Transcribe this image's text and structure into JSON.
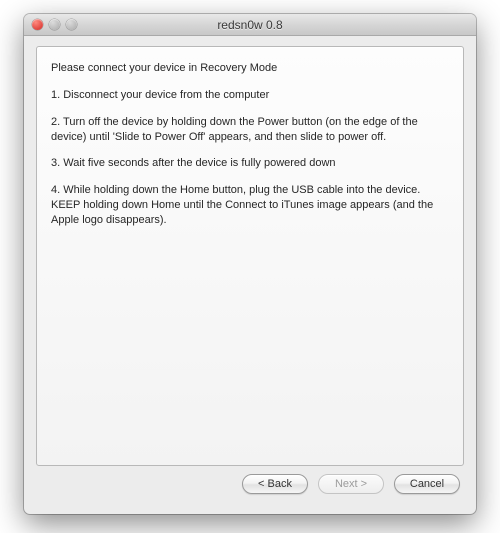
{
  "window": {
    "title": "redsn0w 0.8"
  },
  "content": {
    "heading": "Please connect your device in Recovery Mode",
    "step1": "1. Disconnect your device from the computer",
    "step2": "2. Turn off the device by holding down the Power button (on the edge of the device) until 'Slide to Power Off' appears, and then slide to power off.",
    "step3": "3. Wait five seconds after the device is fully powered down",
    "step4": "4. While holding down the Home button, plug the USB cable into the device. KEEP holding down Home until the Connect to iTunes image appears (and the Apple logo disappears)."
  },
  "buttons": {
    "back": "< Back",
    "next": "Next >",
    "cancel": "Cancel",
    "next_enabled": false
  }
}
